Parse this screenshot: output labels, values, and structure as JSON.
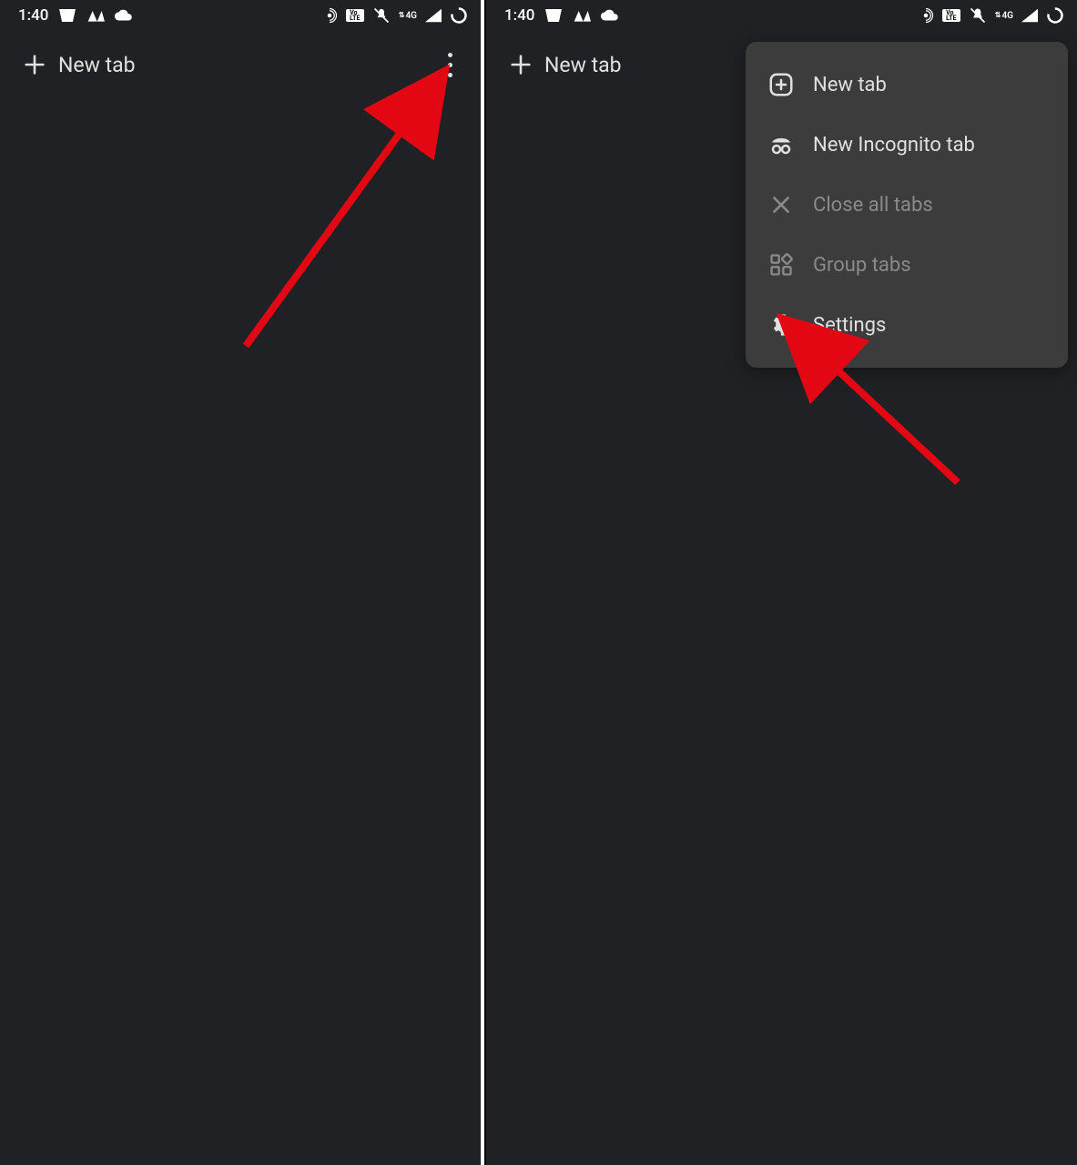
{
  "status": {
    "time": "1:40",
    "net_label": "4G",
    "lte_badge": "Vo\nLTE"
  },
  "toolbar": {
    "new_tab_label": "New tab"
  },
  "menu": {
    "items": [
      {
        "label": "New tab",
        "icon": "plus-box-icon",
        "enabled": true
      },
      {
        "label": "New Incognito tab",
        "icon": "incognito-icon",
        "enabled": true
      },
      {
        "label": "Close all tabs",
        "icon": "close-icon",
        "enabled": false
      },
      {
        "label": "Group tabs",
        "icon": "grid-icon",
        "enabled": false
      },
      {
        "label": "Settings",
        "icon": "gear-icon",
        "enabled": true
      }
    ]
  }
}
